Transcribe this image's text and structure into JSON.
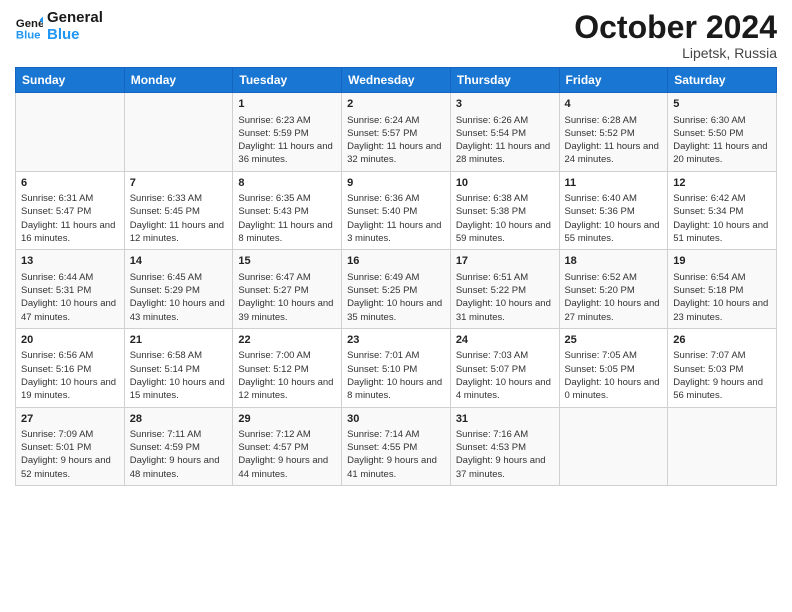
{
  "header": {
    "logo_general": "General",
    "logo_blue": "Blue",
    "month": "October 2024",
    "location": "Lipetsk, Russia"
  },
  "weekdays": [
    "Sunday",
    "Monday",
    "Tuesday",
    "Wednesday",
    "Thursday",
    "Friday",
    "Saturday"
  ],
  "weeks": [
    [
      {
        "day": "",
        "info": ""
      },
      {
        "day": "",
        "info": ""
      },
      {
        "day": "1",
        "info": "Sunrise: 6:23 AM\nSunset: 5:59 PM\nDaylight: 11 hours and 36 minutes."
      },
      {
        "day": "2",
        "info": "Sunrise: 6:24 AM\nSunset: 5:57 PM\nDaylight: 11 hours and 32 minutes."
      },
      {
        "day": "3",
        "info": "Sunrise: 6:26 AM\nSunset: 5:54 PM\nDaylight: 11 hours and 28 minutes."
      },
      {
        "day": "4",
        "info": "Sunrise: 6:28 AM\nSunset: 5:52 PM\nDaylight: 11 hours and 24 minutes."
      },
      {
        "day": "5",
        "info": "Sunrise: 6:30 AM\nSunset: 5:50 PM\nDaylight: 11 hours and 20 minutes."
      }
    ],
    [
      {
        "day": "6",
        "info": "Sunrise: 6:31 AM\nSunset: 5:47 PM\nDaylight: 11 hours and 16 minutes."
      },
      {
        "day": "7",
        "info": "Sunrise: 6:33 AM\nSunset: 5:45 PM\nDaylight: 11 hours and 12 minutes."
      },
      {
        "day": "8",
        "info": "Sunrise: 6:35 AM\nSunset: 5:43 PM\nDaylight: 11 hours and 8 minutes."
      },
      {
        "day": "9",
        "info": "Sunrise: 6:36 AM\nSunset: 5:40 PM\nDaylight: 11 hours and 3 minutes."
      },
      {
        "day": "10",
        "info": "Sunrise: 6:38 AM\nSunset: 5:38 PM\nDaylight: 10 hours and 59 minutes."
      },
      {
        "day": "11",
        "info": "Sunrise: 6:40 AM\nSunset: 5:36 PM\nDaylight: 10 hours and 55 minutes."
      },
      {
        "day": "12",
        "info": "Sunrise: 6:42 AM\nSunset: 5:34 PM\nDaylight: 10 hours and 51 minutes."
      }
    ],
    [
      {
        "day": "13",
        "info": "Sunrise: 6:44 AM\nSunset: 5:31 PM\nDaylight: 10 hours and 47 minutes."
      },
      {
        "day": "14",
        "info": "Sunrise: 6:45 AM\nSunset: 5:29 PM\nDaylight: 10 hours and 43 minutes."
      },
      {
        "day": "15",
        "info": "Sunrise: 6:47 AM\nSunset: 5:27 PM\nDaylight: 10 hours and 39 minutes."
      },
      {
        "day": "16",
        "info": "Sunrise: 6:49 AM\nSunset: 5:25 PM\nDaylight: 10 hours and 35 minutes."
      },
      {
        "day": "17",
        "info": "Sunrise: 6:51 AM\nSunset: 5:22 PM\nDaylight: 10 hours and 31 minutes."
      },
      {
        "day": "18",
        "info": "Sunrise: 6:52 AM\nSunset: 5:20 PM\nDaylight: 10 hours and 27 minutes."
      },
      {
        "day": "19",
        "info": "Sunrise: 6:54 AM\nSunset: 5:18 PM\nDaylight: 10 hours and 23 minutes."
      }
    ],
    [
      {
        "day": "20",
        "info": "Sunrise: 6:56 AM\nSunset: 5:16 PM\nDaylight: 10 hours and 19 minutes."
      },
      {
        "day": "21",
        "info": "Sunrise: 6:58 AM\nSunset: 5:14 PM\nDaylight: 10 hours and 15 minutes."
      },
      {
        "day": "22",
        "info": "Sunrise: 7:00 AM\nSunset: 5:12 PM\nDaylight: 10 hours and 12 minutes."
      },
      {
        "day": "23",
        "info": "Sunrise: 7:01 AM\nSunset: 5:10 PM\nDaylight: 10 hours and 8 minutes."
      },
      {
        "day": "24",
        "info": "Sunrise: 7:03 AM\nSunset: 5:07 PM\nDaylight: 10 hours and 4 minutes."
      },
      {
        "day": "25",
        "info": "Sunrise: 7:05 AM\nSunset: 5:05 PM\nDaylight: 10 hours and 0 minutes."
      },
      {
        "day": "26",
        "info": "Sunrise: 7:07 AM\nSunset: 5:03 PM\nDaylight: 9 hours and 56 minutes."
      }
    ],
    [
      {
        "day": "27",
        "info": "Sunrise: 7:09 AM\nSunset: 5:01 PM\nDaylight: 9 hours and 52 minutes."
      },
      {
        "day": "28",
        "info": "Sunrise: 7:11 AM\nSunset: 4:59 PM\nDaylight: 9 hours and 48 minutes."
      },
      {
        "day": "29",
        "info": "Sunrise: 7:12 AM\nSunset: 4:57 PM\nDaylight: 9 hours and 44 minutes."
      },
      {
        "day": "30",
        "info": "Sunrise: 7:14 AM\nSunset: 4:55 PM\nDaylight: 9 hours and 41 minutes."
      },
      {
        "day": "31",
        "info": "Sunrise: 7:16 AM\nSunset: 4:53 PM\nDaylight: 9 hours and 37 minutes."
      },
      {
        "day": "",
        "info": ""
      },
      {
        "day": "",
        "info": ""
      }
    ]
  ]
}
